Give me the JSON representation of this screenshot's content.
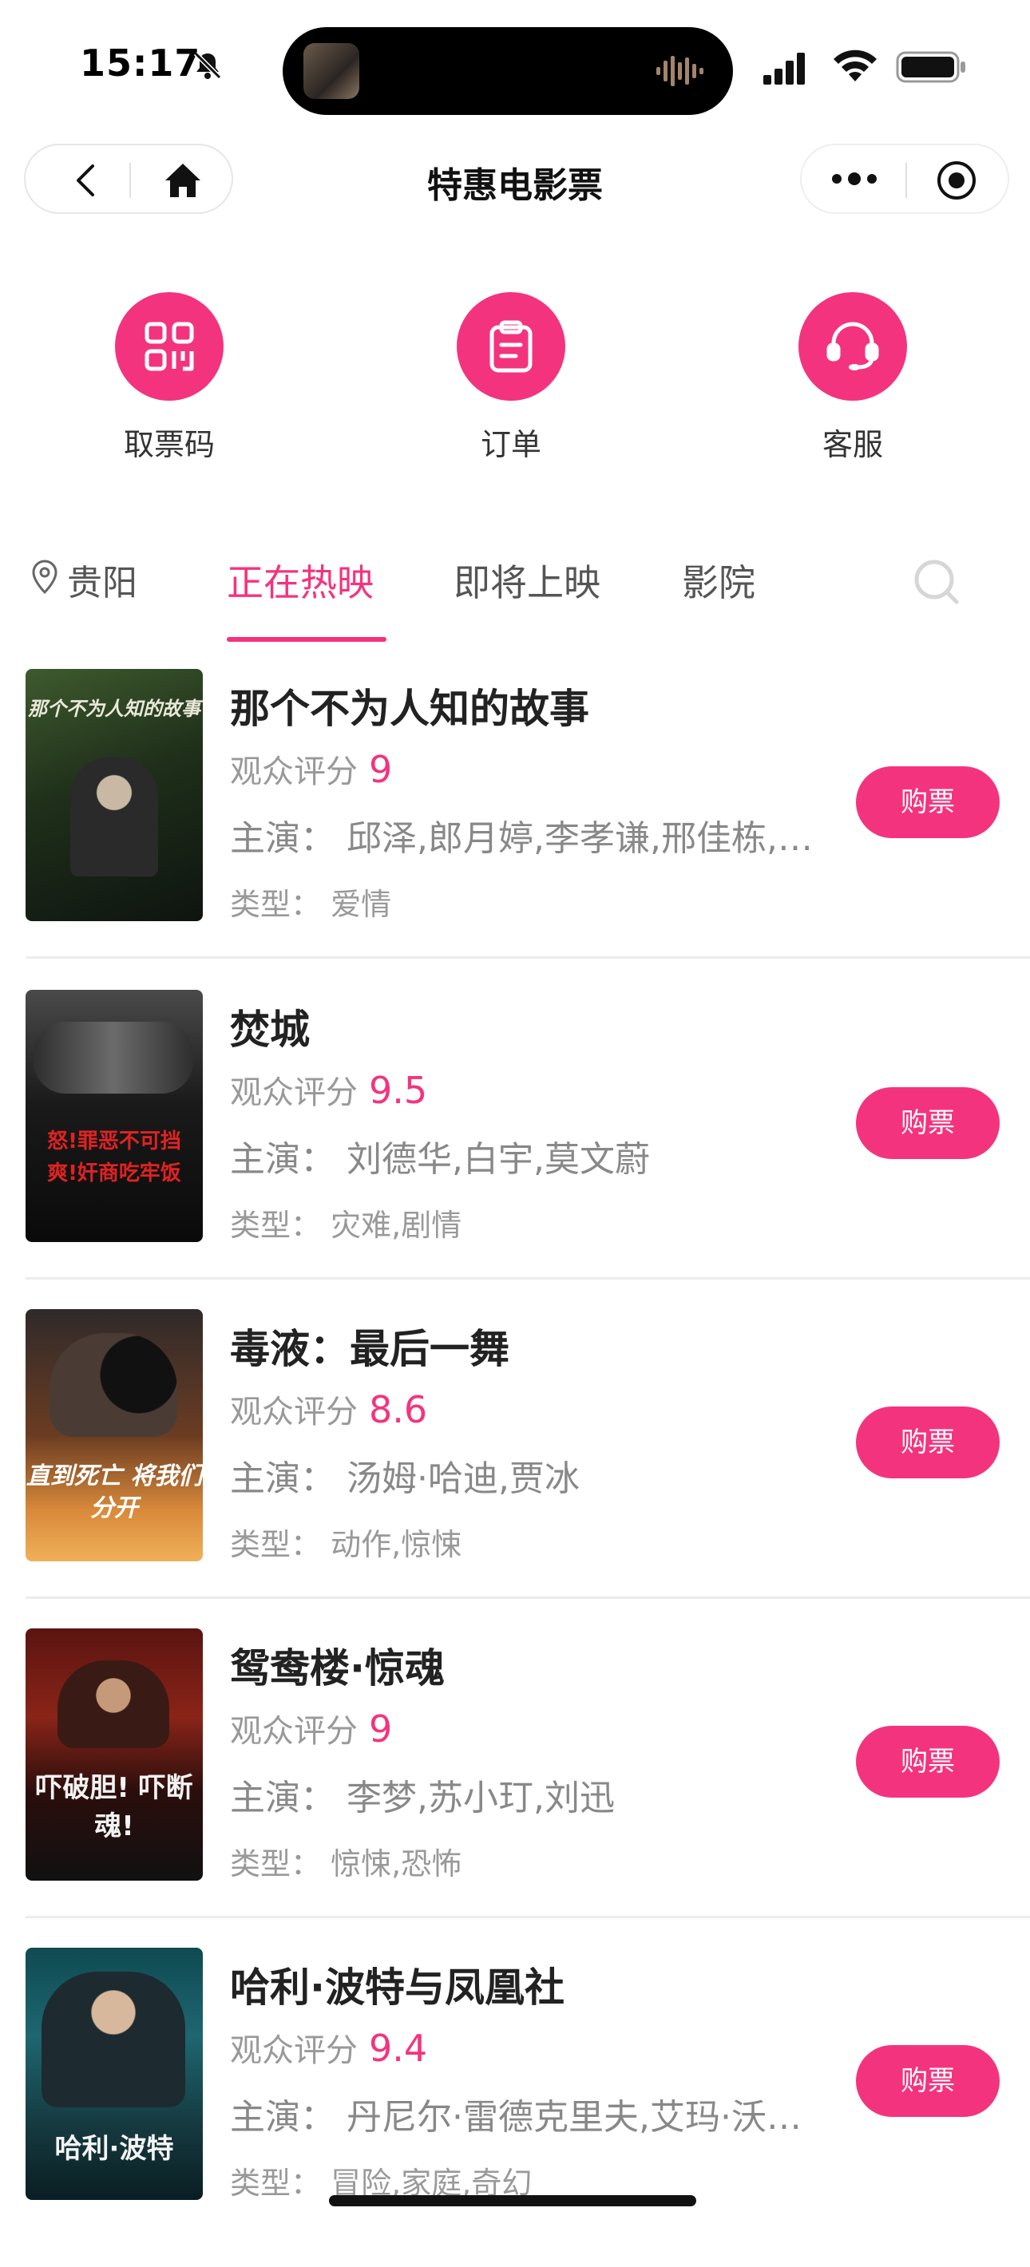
{
  "status_bar": {
    "time": "15:17",
    "icons": [
      "bell-slash-icon",
      "audio-wave-icon",
      "signal-icon",
      "wifi-icon",
      "battery-icon"
    ]
  },
  "nav": {
    "title": "特惠电影票",
    "left_icons": [
      "back-icon",
      "home-icon"
    ],
    "right_icons": [
      "more-icon",
      "target-icon"
    ]
  },
  "quick_actions": [
    {
      "label": "取票码",
      "icon": "ticket-code-icon"
    },
    {
      "label": "订单",
      "icon": "clipboard-icon"
    },
    {
      "label": "客服",
      "icon": "headset-icon"
    }
  ],
  "tabs": {
    "city": "贵阳",
    "items": [
      "正在热映",
      "即将上映",
      "影院"
    ],
    "active": "正在热映"
  },
  "colors": {
    "accent": "#f4337f",
    "text_primary": "#222222",
    "text_secondary": "#999999"
  },
  "rating_label": "观众评分",
  "cast_label": "主演：",
  "genre_label": "类型：",
  "buy_label": "购票",
  "movies": [
    {
      "title": "那个不为人知的故事",
      "score": "9",
      "cast": "邱泽,郎月婷,李孝谦,邢佳栋,…",
      "genre": "爱情",
      "poster_text": "那个不为人知的故事"
    },
    {
      "title": "焚城",
      "score": "9.5",
      "cast": "刘德华,白宇,莫文蔚",
      "genre": "灾难,剧情",
      "poster_text": "怒!罪恶不可挡 爽!奸商吃牢饭"
    },
    {
      "title": "毒液：最后一舞",
      "score": "8.6",
      "cast": "汤姆·哈迪,贾冰",
      "genre": "动作,惊悚",
      "poster_text": "直到死亡 将我们分开"
    },
    {
      "title": "鸳鸯楼·惊魂",
      "score": "9",
      "cast": "李梦,苏小玎,刘迅",
      "genre": "惊悚,恐怖",
      "poster_text": "吓破胆! 吓断魂!"
    },
    {
      "title": "哈利·波特与凤凰社",
      "score": "9.4",
      "cast": "丹尼尔·雷德克里夫,艾玛·沃…",
      "genre": "冒险,家庭,奇幻",
      "poster_text": "哈利·波特"
    }
  ]
}
